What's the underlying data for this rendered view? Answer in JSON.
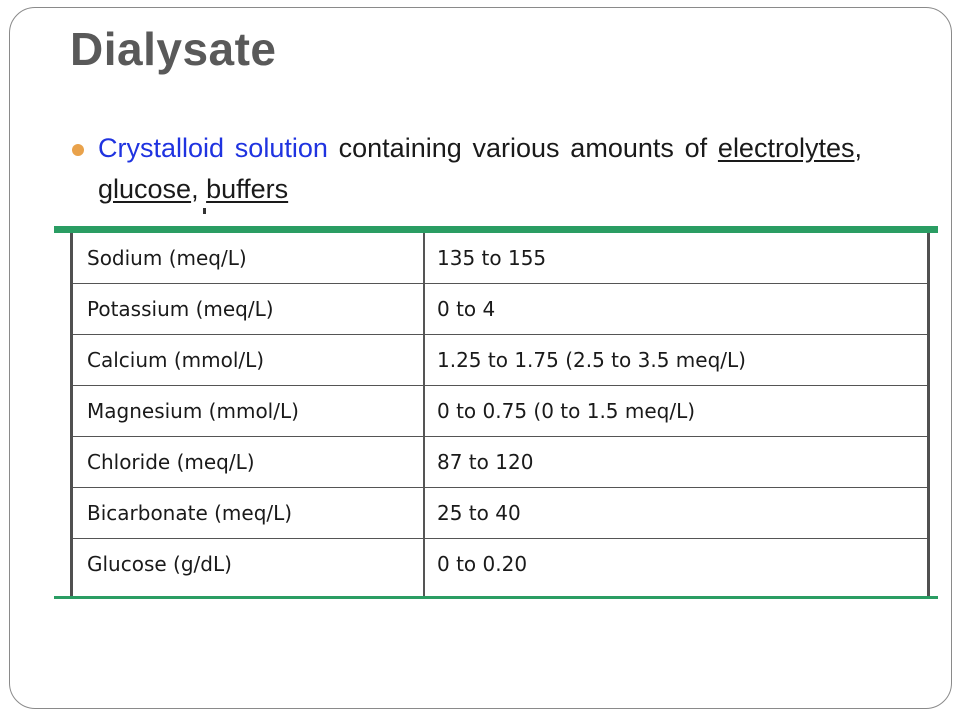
{
  "slide": {
    "title": "Dialysate",
    "bullet": {
      "highlight": "Crystalloid solution",
      "text": " containing various amounts of ",
      "items": [
        "electrolytes",
        "glucose",
        "buffers"
      ],
      "sep1": ", ",
      "sep2": ", "
    }
  },
  "table": {
    "rows": [
      {
        "label": "Sodium (meq/L)",
        "value": "135 to 155"
      },
      {
        "label": "Potassium (meq/L)",
        "value": "0 to 4"
      },
      {
        "label": "Calcium (mmol/L)",
        "value": "1.25 to 1.75 (2.5 to 3.5 meq/L)"
      },
      {
        "label": "Magnesium (mmol/L)",
        "value": "0 to 0.75 (0 to 1.5 meq/L)"
      },
      {
        "label": "Chloride (meq/L)",
        "value": "87 to 120"
      },
      {
        "label": "Bicarbonate (meq/L)",
        "value": "25 to 40"
      },
      {
        "label": "Glucose (g/dL)",
        "value": "0 to 0.20"
      }
    ]
  },
  "colors": {
    "accent_green": "#2a9d63",
    "link_blue": "#1f33e0",
    "bullet_orange": "#e9a24b",
    "title_gray": "#595959"
  }
}
